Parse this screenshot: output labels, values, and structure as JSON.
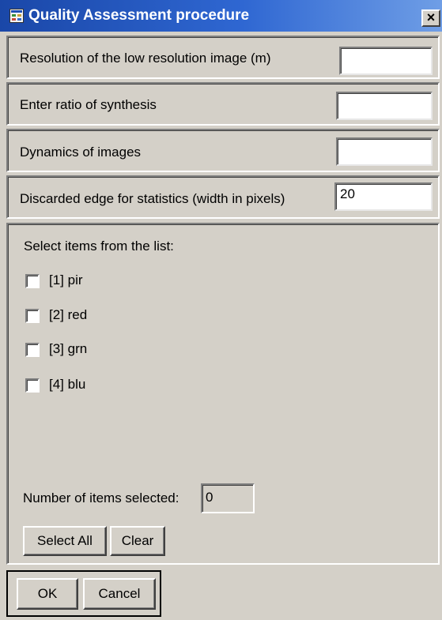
{
  "window": {
    "title": "Quality Assessment procedure",
    "close_glyph": "×",
    "icon": "app-icon"
  },
  "params": [
    {
      "label": "Resolution of the low resolution image (m)",
      "value": ""
    },
    {
      "label": "Enter ratio of synthesis",
      "value": ""
    },
    {
      "label": "Dynamics of images",
      "value": ""
    },
    {
      "label": "Discarded edge for statistics (width in pixels)",
      "value": "20"
    }
  ],
  "list": {
    "heading": "Select items from the list:",
    "items": [
      {
        "label": "[1] pir",
        "checked": false
      },
      {
        "label": "[2] red",
        "checked": false
      },
      {
        "label": "[3] grn",
        "checked": false
      },
      {
        "label": "[4] blu",
        "checked": false
      }
    ],
    "count_label": "Number of items selected:",
    "count_value": "0",
    "select_all_label": "Select All",
    "clear_label": "Clear"
  },
  "footer": {
    "ok_label": "OK",
    "cancel_label": "Cancel"
  }
}
